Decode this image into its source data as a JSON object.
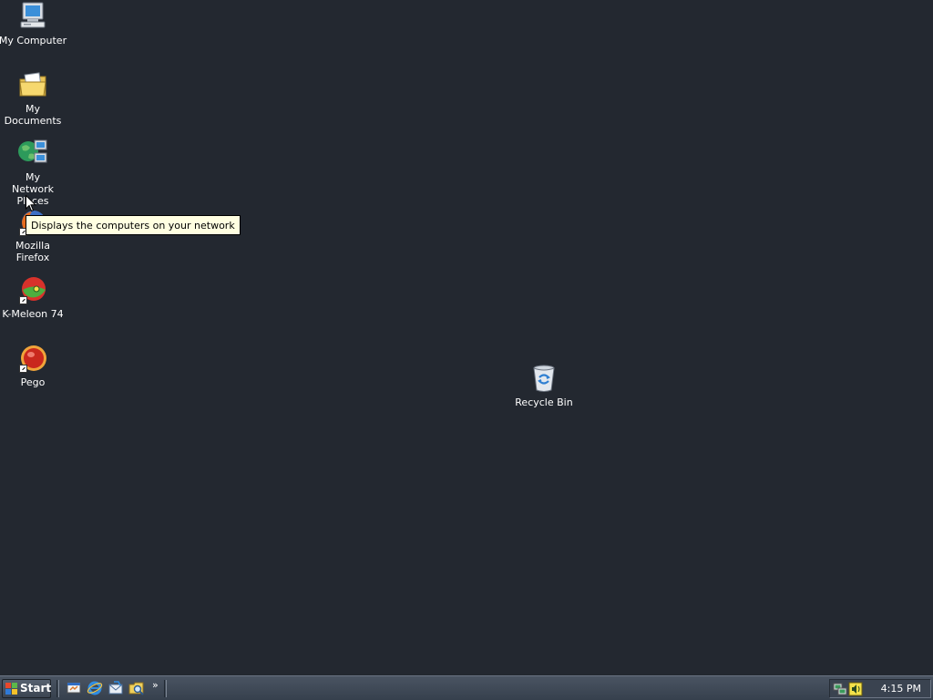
{
  "desktop": {
    "icons": [
      {
        "label": "My Computer",
        "icon": "my-computer-icon"
      },
      {
        "label": "My Documents",
        "icon": "my-documents-icon"
      },
      {
        "label": "My Network Places",
        "icon": "my-network-places-icon"
      },
      {
        "label": "Mozilla Firefox",
        "icon": "firefox-icon",
        "shortcut": true
      },
      {
        "label": "K-Meleon 74",
        "icon": "k-meleon-icon",
        "shortcut": true
      },
      {
        "label": "Pego",
        "icon": "pego-icon",
        "shortcut": true
      },
      {
        "label": "Recycle Bin",
        "icon": "recycle-bin-icon"
      }
    ],
    "tooltip": "Displays the computers on your network"
  },
  "taskbar": {
    "start_label": "Start",
    "quick_launch": [
      "show-desktop-icon",
      "internet-explorer-icon",
      "outlook-express-icon",
      "windows-explorer-icon"
    ],
    "overflow_label": "»",
    "tray_icons": [
      "network-icon",
      "volume-icon"
    ],
    "clock": "4:15 PM"
  },
  "colors": {
    "desktop_background": "#232830",
    "taskbar": "#404a57",
    "tooltip_background": "#ffffe1"
  }
}
